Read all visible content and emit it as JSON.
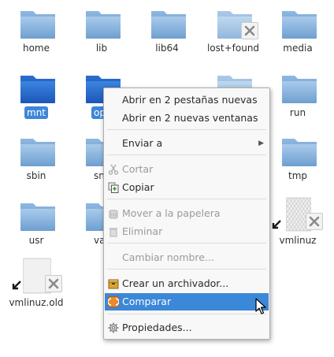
{
  "files": [
    {
      "name": "home",
      "type": "folder"
    },
    {
      "name": "lib",
      "type": "folder"
    },
    {
      "name": "lib64",
      "type": "folder"
    },
    {
      "name": "lost+found",
      "type": "folder-locked"
    },
    {
      "name": "media",
      "type": "folder"
    },
    {
      "name": "mnt",
      "type": "folder",
      "selected": true
    },
    {
      "name": "op",
      "type": "folder",
      "selected": true
    },
    {
      "name": "run",
      "type": "folder"
    },
    {
      "name": "sbin",
      "type": "folder"
    },
    {
      "name": "sn",
      "type": "folder"
    },
    {
      "name": "tmp",
      "type": "folder"
    },
    {
      "name": "usr",
      "type": "folder"
    },
    {
      "name": "va",
      "type": "folder"
    },
    {
      "name": "vmlinuz",
      "type": "broken-link"
    },
    {
      "name": "vmlinuz.old",
      "type": "broken-link"
    }
  ],
  "context_menu": {
    "items": [
      {
        "label": "Abrir en 2 pestañas nuevas",
        "enabled": true
      },
      {
        "label": "Abrir en 2 nuevas ventanas",
        "enabled": true
      },
      {
        "label": "Enviar a",
        "enabled": true,
        "submenu": true
      },
      {
        "label": "Cortar",
        "enabled": false,
        "icon": "scissors-icon"
      },
      {
        "label": "Copiar",
        "enabled": true,
        "icon": "copy-icon"
      },
      {
        "label": "Mover a la papelera",
        "enabled": false,
        "icon": "trash-move-icon"
      },
      {
        "label": "Eliminar",
        "enabled": false,
        "icon": "delete-icon"
      },
      {
        "label": "Cambiar nombre...",
        "enabled": false
      },
      {
        "label": "Crear un archivador...",
        "enabled": true,
        "icon": "archive-icon"
      },
      {
        "label": "Comparar",
        "enabled": true,
        "icon": "compare-icon",
        "highlighted": true
      },
      {
        "label": "Propiedades...",
        "enabled": true,
        "icon": "gear-icon"
      }
    ]
  },
  "colors": {
    "folder_light": "#7fb0e0",
    "folder_selected": "#2e6fce",
    "highlight": "#3b87d8"
  }
}
